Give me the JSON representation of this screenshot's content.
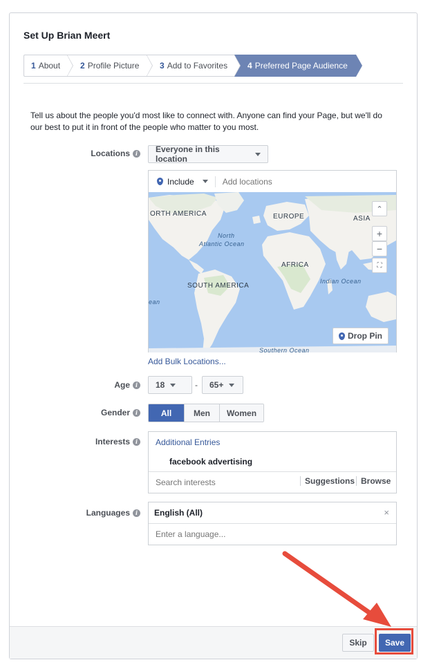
{
  "dialog": {
    "title": "Set Up Brian Meert",
    "steps": [
      {
        "num": "1",
        "label": "About"
      },
      {
        "num": "2",
        "label": "Profile Picture"
      },
      {
        "num": "3",
        "label": "Add to Favorites"
      },
      {
        "num": "4",
        "label": "Preferred Page Audience"
      }
    ],
    "intro": "Tell us about the people you'd most like to connect with. Anyone can find your Page, but we'll do our best to put it in front of the people who matter to you most."
  },
  "locations": {
    "label": "Locations",
    "scope_value": "Everyone in this location",
    "include_value": "Include",
    "input_placeholder": "Add locations",
    "map_labels": {
      "north_america": "ORTH AMERICA",
      "europe": "EUROPE",
      "asia": "ASIA",
      "africa": "AFRICA",
      "south_america": "SOUTH AMERICA",
      "north": "North",
      "atlantic": "Atlantic Ocean",
      "indian": "Indian Ocean",
      "southern": "Southern Ocean",
      "edge": "ean"
    },
    "drop_pin": "Drop Pin",
    "bulk_link": "Add Bulk Locations..."
  },
  "age": {
    "label": "Age",
    "min": "18",
    "separator": "-",
    "max": "65+"
  },
  "gender": {
    "label": "Gender",
    "options": [
      "All",
      "Men",
      "Women"
    ],
    "selected": "All"
  },
  "interests": {
    "label": "Interests",
    "header": "Additional Entries",
    "entry": "facebook advertising",
    "placeholder": "Search interests",
    "suggestions": "Suggestions",
    "browse": "Browse"
  },
  "languages": {
    "label": "Languages",
    "selected": "English (All)",
    "placeholder": "Enter a language..."
  },
  "footer": {
    "skip": "Skip",
    "save": "Save"
  },
  "colors": {
    "accent": "#4267b2",
    "step_active": "#6d84b4",
    "link": "#365899",
    "highlight": "#e74c3c",
    "annotation_arrow": "#e74c3c"
  }
}
